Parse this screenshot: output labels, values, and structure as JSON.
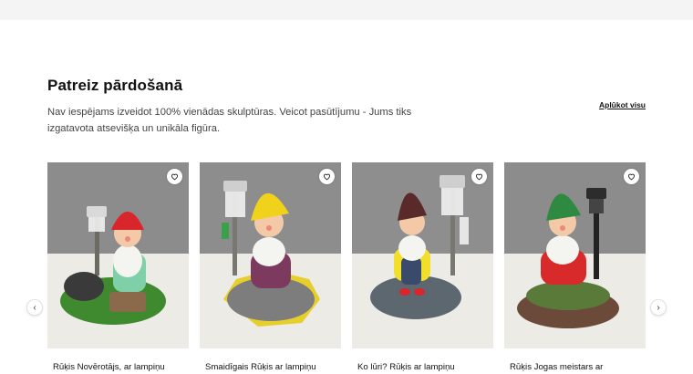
{
  "section": {
    "title": "Patreiz pārdošanā",
    "description": "Nav iespējams izveidot 100% vienādas skulptūras. Veicot pasūtījumu - Jums tiks izgatavota atsevišķa un unikāla figūra.",
    "view_all_label": "Aplūkot visu"
  },
  "products": [
    {
      "title": "Rūķis Novērotājs, ar lampiņu",
      "hat_color": "#d8262c",
      "shirt_color": "#7fd0a8",
      "base_color": "#3f8a2f"
    },
    {
      "title": "Smaidīgais Rūķis ar lampiņu",
      "hat_color": "#f0d21a",
      "shirt_color": "#7b3a5e",
      "base_color": "#7d7d7d"
    },
    {
      "title": "Ko lūri? Rūķis ar lampiņu",
      "hat_color": "#5a2a2a",
      "shirt_color": "#f2df2a",
      "base_color": "#5c6770"
    },
    {
      "title": "Rūķis Jogas meistars ar",
      "hat_color": "#2e8a40",
      "shirt_color": "#d82a2a",
      "base_color": "#6b4a3a"
    }
  ],
  "icons": {
    "favorite": "heart-icon",
    "prev": "chevron-left-icon",
    "next": "chevron-right-icon"
  },
  "carousel": {
    "prev_glyph": "‹",
    "next_glyph": "›"
  }
}
